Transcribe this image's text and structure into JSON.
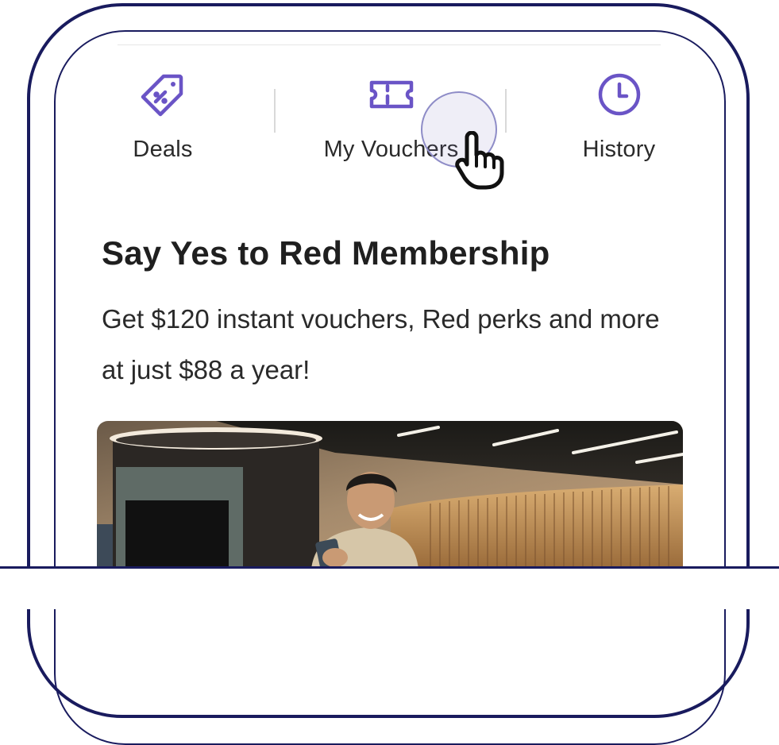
{
  "tabs": {
    "deals": {
      "label": "Deals",
      "icon": "tag-icon"
    },
    "vouchers": {
      "label": "My Vouchers",
      "icon": "ticket-icon"
    },
    "history": {
      "label": "History",
      "icon": "clock-icon"
    }
  },
  "promo": {
    "title": "Say Yes to Red Membership",
    "description": "Get $120 instant vouchers, Red perks and more at just $88 a year!"
  },
  "colors": {
    "accent": "#6a54c6",
    "frame": "#191b5e"
  },
  "hero_image": {
    "icon": "promo-photo"
  }
}
